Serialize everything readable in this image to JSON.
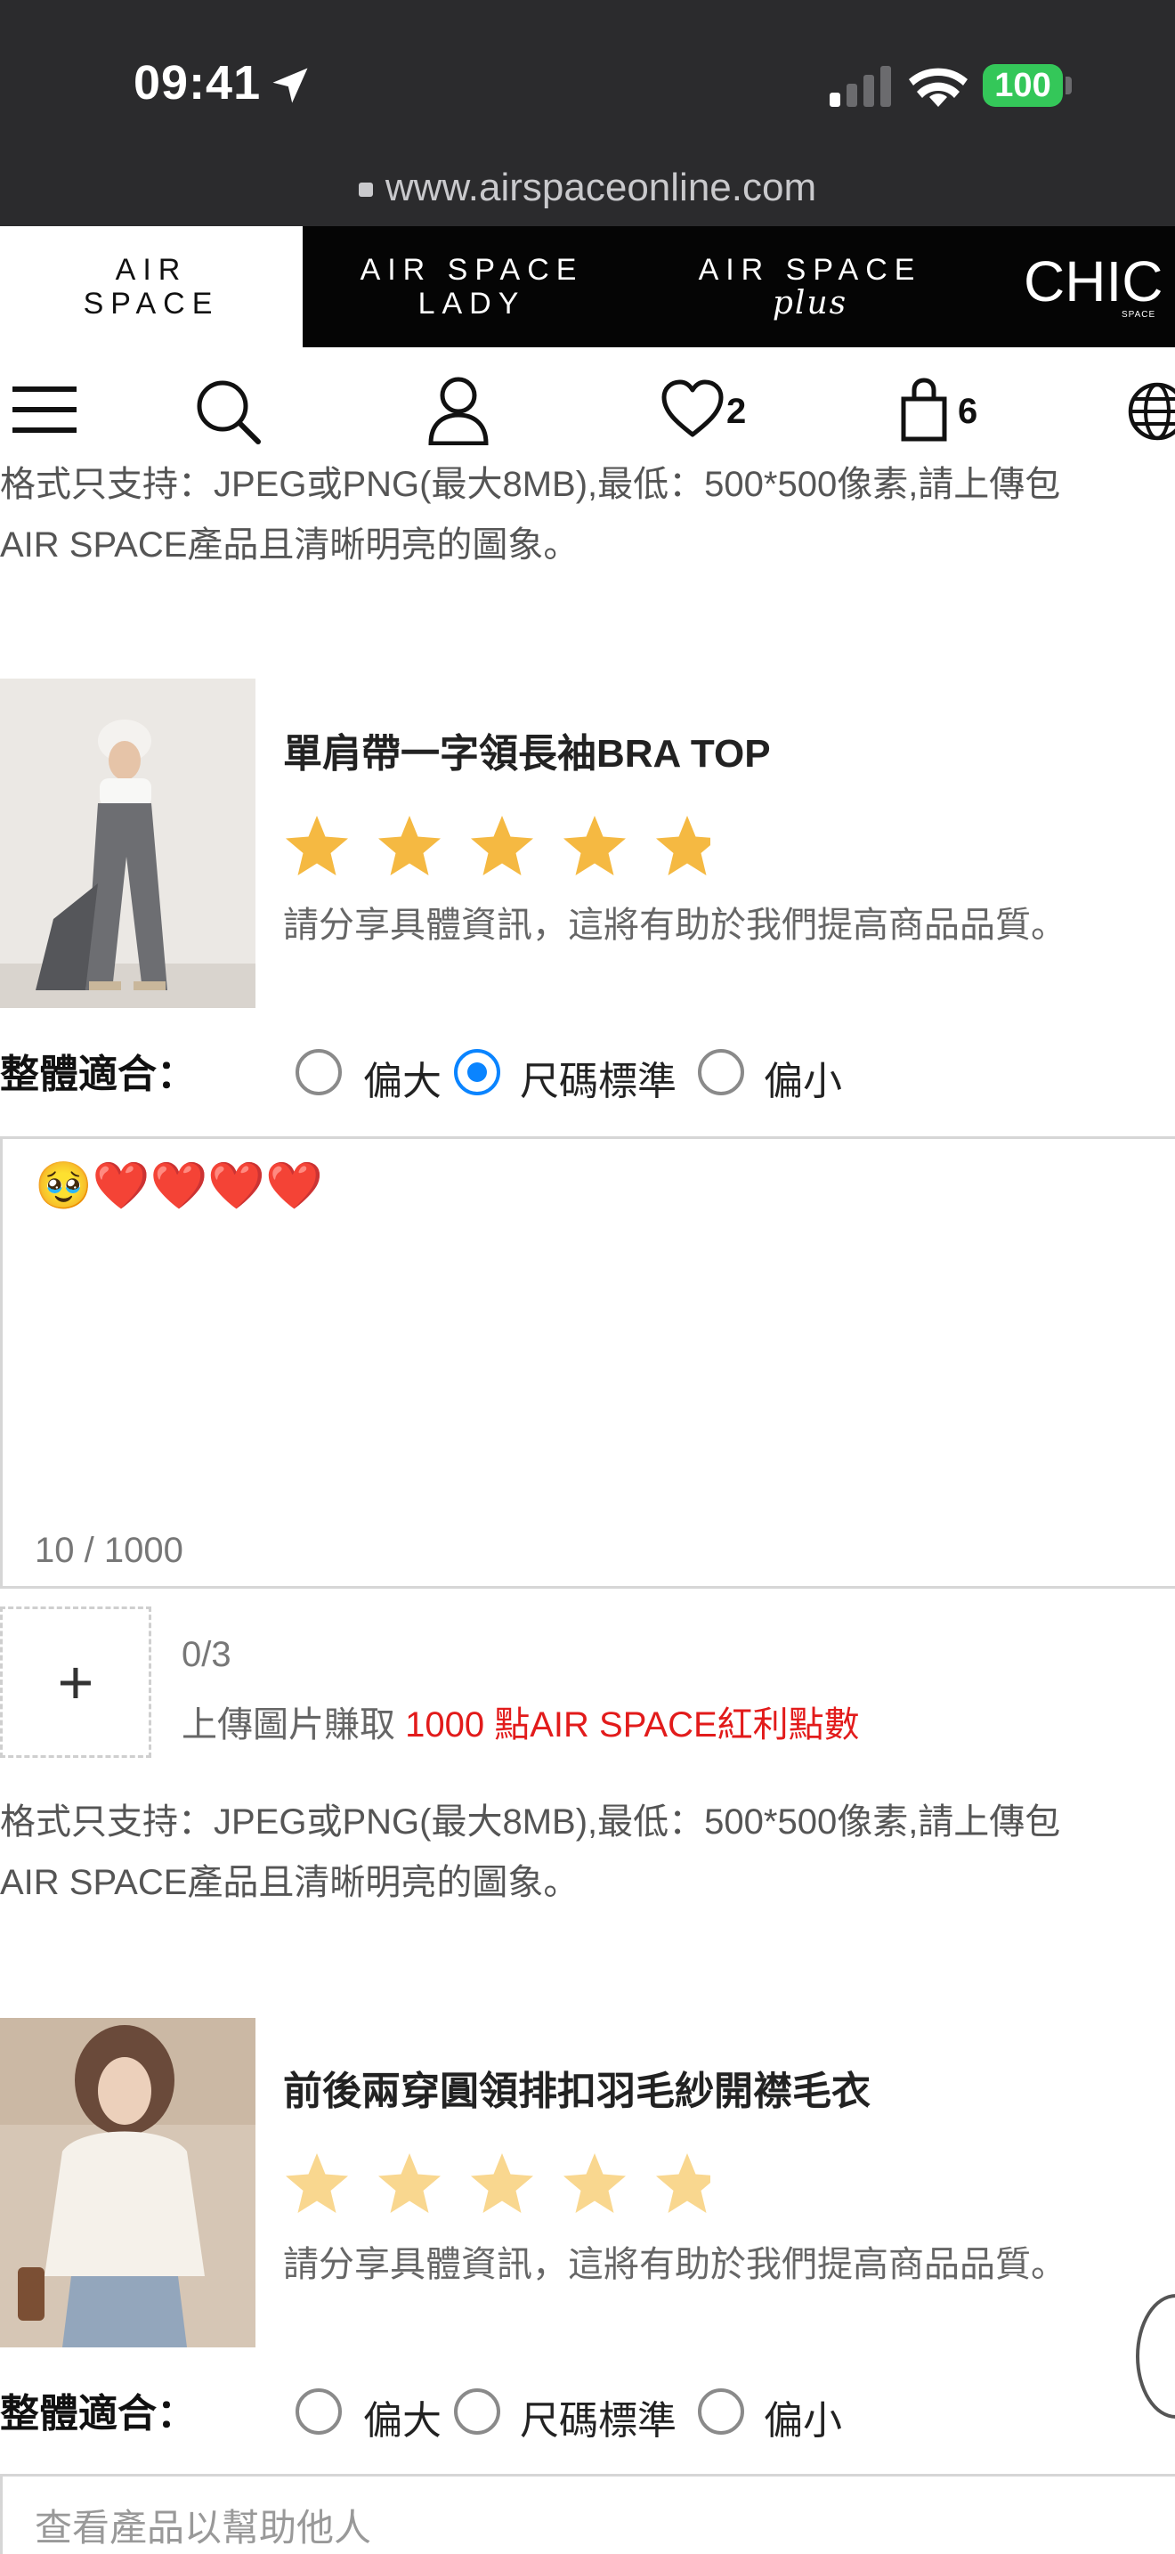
{
  "status": {
    "time": "09:41",
    "battery": "100"
  },
  "browser": {
    "url": "www.airspaceonline.com"
  },
  "brands": [
    {
      "line1": "AIR",
      "line2": "SPACE"
    },
    {
      "line1": "AIR SPACE",
      "line2": "LADY"
    },
    {
      "line1": "AIR SPACE",
      "line2": "plus"
    },
    {
      "line1": "CHIC",
      "line2": "SPACE"
    }
  ],
  "nav": {
    "wishlist_count": "2",
    "cart_count": "6"
  },
  "format_note": {
    "line1": "格式只支持：JPEG或PNG(最大8MB),最低：500*500像素,請上傳包",
    "line2": "AIR SPACE產品且清晰明亮的圖象。"
  },
  "reviews": [
    {
      "product_name": "單肩帶一字領長袖BRA TOP",
      "rating": 5,
      "prompt": "請分享具體資訊，這將有助於我們提高商品品質。",
      "fit_label": "整體適合：",
      "fit_options": [
        "偏大",
        "尺碼標準",
        "偏小"
      ],
      "fit_selected": "尺碼標準",
      "review_text": "🥹❤️❤️❤️❤️",
      "char_count": "10 / 1000",
      "upload_count": "0/3",
      "upload_text": "上傳圖片賺取",
      "upload_reward": "1000 點AIR SPACE紅利點數",
      "upload_plus": "+"
    },
    {
      "product_name": "前後兩穿圓領排扣羽毛紗開襟毛衣",
      "rating": 0,
      "prompt": "請分享具體資訊，這將有助於我們提高商品品質。",
      "fit_label": "整體適合：",
      "fit_options": [
        "偏大",
        "尺碼標準",
        "偏小"
      ],
      "fit_selected": "",
      "review_placeholder": "查看產品以幫助他人"
    }
  ],
  "colors": {
    "star_active": "#f5b942",
    "star_inactive": "#f9d78f",
    "radio_selected": "#0a84ff",
    "reward_red": "#e21b1b"
  }
}
